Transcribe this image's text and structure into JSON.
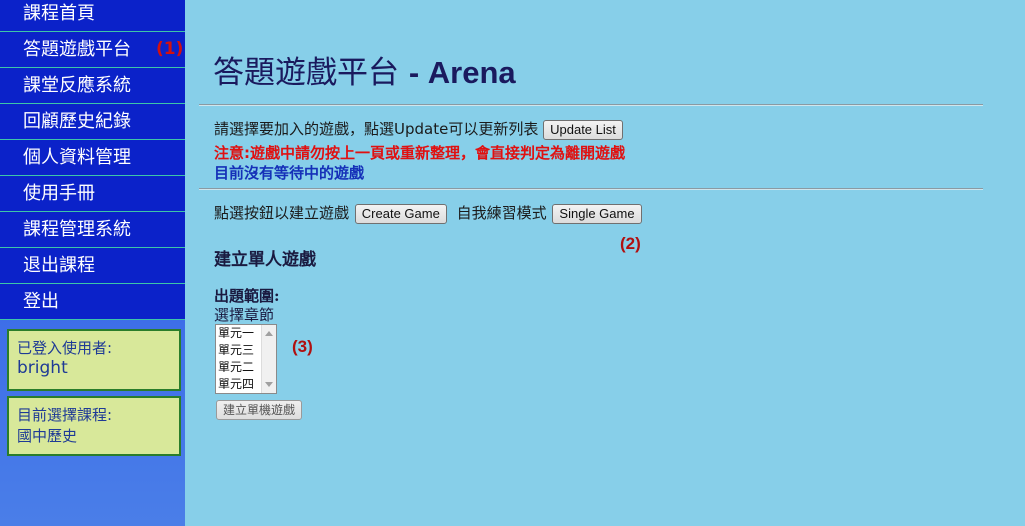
{
  "sidebar": {
    "items": [
      {
        "label": "課程首頁"
      },
      {
        "label": "答題遊戲平台",
        "marker": "(1)"
      },
      {
        "label": "課堂反應系統"
      },
      {
        "label": "回顧歷史紀錄"
      },
      {
        "label": "個人資料管理"
      },
      {
        "label": "使用手冊"
      },
      {
        "label": "課程管理系統"
      },
      {
        "label": "退出課程"
      },
      {
        "label": "登出"
      }
    ],
    "user_box": {
      "label": "已登入使用者:",
      "value": "bright"
    },
    "course_box": {
      "label": "目前選擇課程:",
      "value": "國中歷史"
    }
  },
  "main": {
    "title_zh": "答題遊戲平台",
    "title_en": "- Arena",
    "instruction": "請選擇要加入的遊戲，點選Update可以更新列表",
    "update_button": "Update List",
    "warning": "注意:遊戲中請勿按上一頁或重新整理，會直接判定為離開遊戲",
    "waiting_status": "目前沒有等待中的遊戲",
    "create_prompt": "點選按鈕以建立遊戲",
    "create_button": "Create Game",
    "self_practice_label": "自我練習模式",
    "single_button": "Single Game",
    "marker_2": "(2)",
    "marker_3": "(3)",
    "section_title": "建立單人遊戲",
    "scope_label": "出題範圍:",
    "chapter_label": "選擇章節",
    "chapters": [
      "單元一",
      "單元三",
      "單元二",
      "單元四"
    ],
    "create_single_button": "建立單機遊戲"
  },
  "colors": {
    "page_background": "#87cfe9",
    "nav_background": "#0b22c9",
    "nav_divider": "#3dc5a8",
    "info_box_background": "#d8e89a",
    "warning_text": "#e01010",
    "status_text": "#1530b8",
    "marker_text": "#b01010"
  }
}
